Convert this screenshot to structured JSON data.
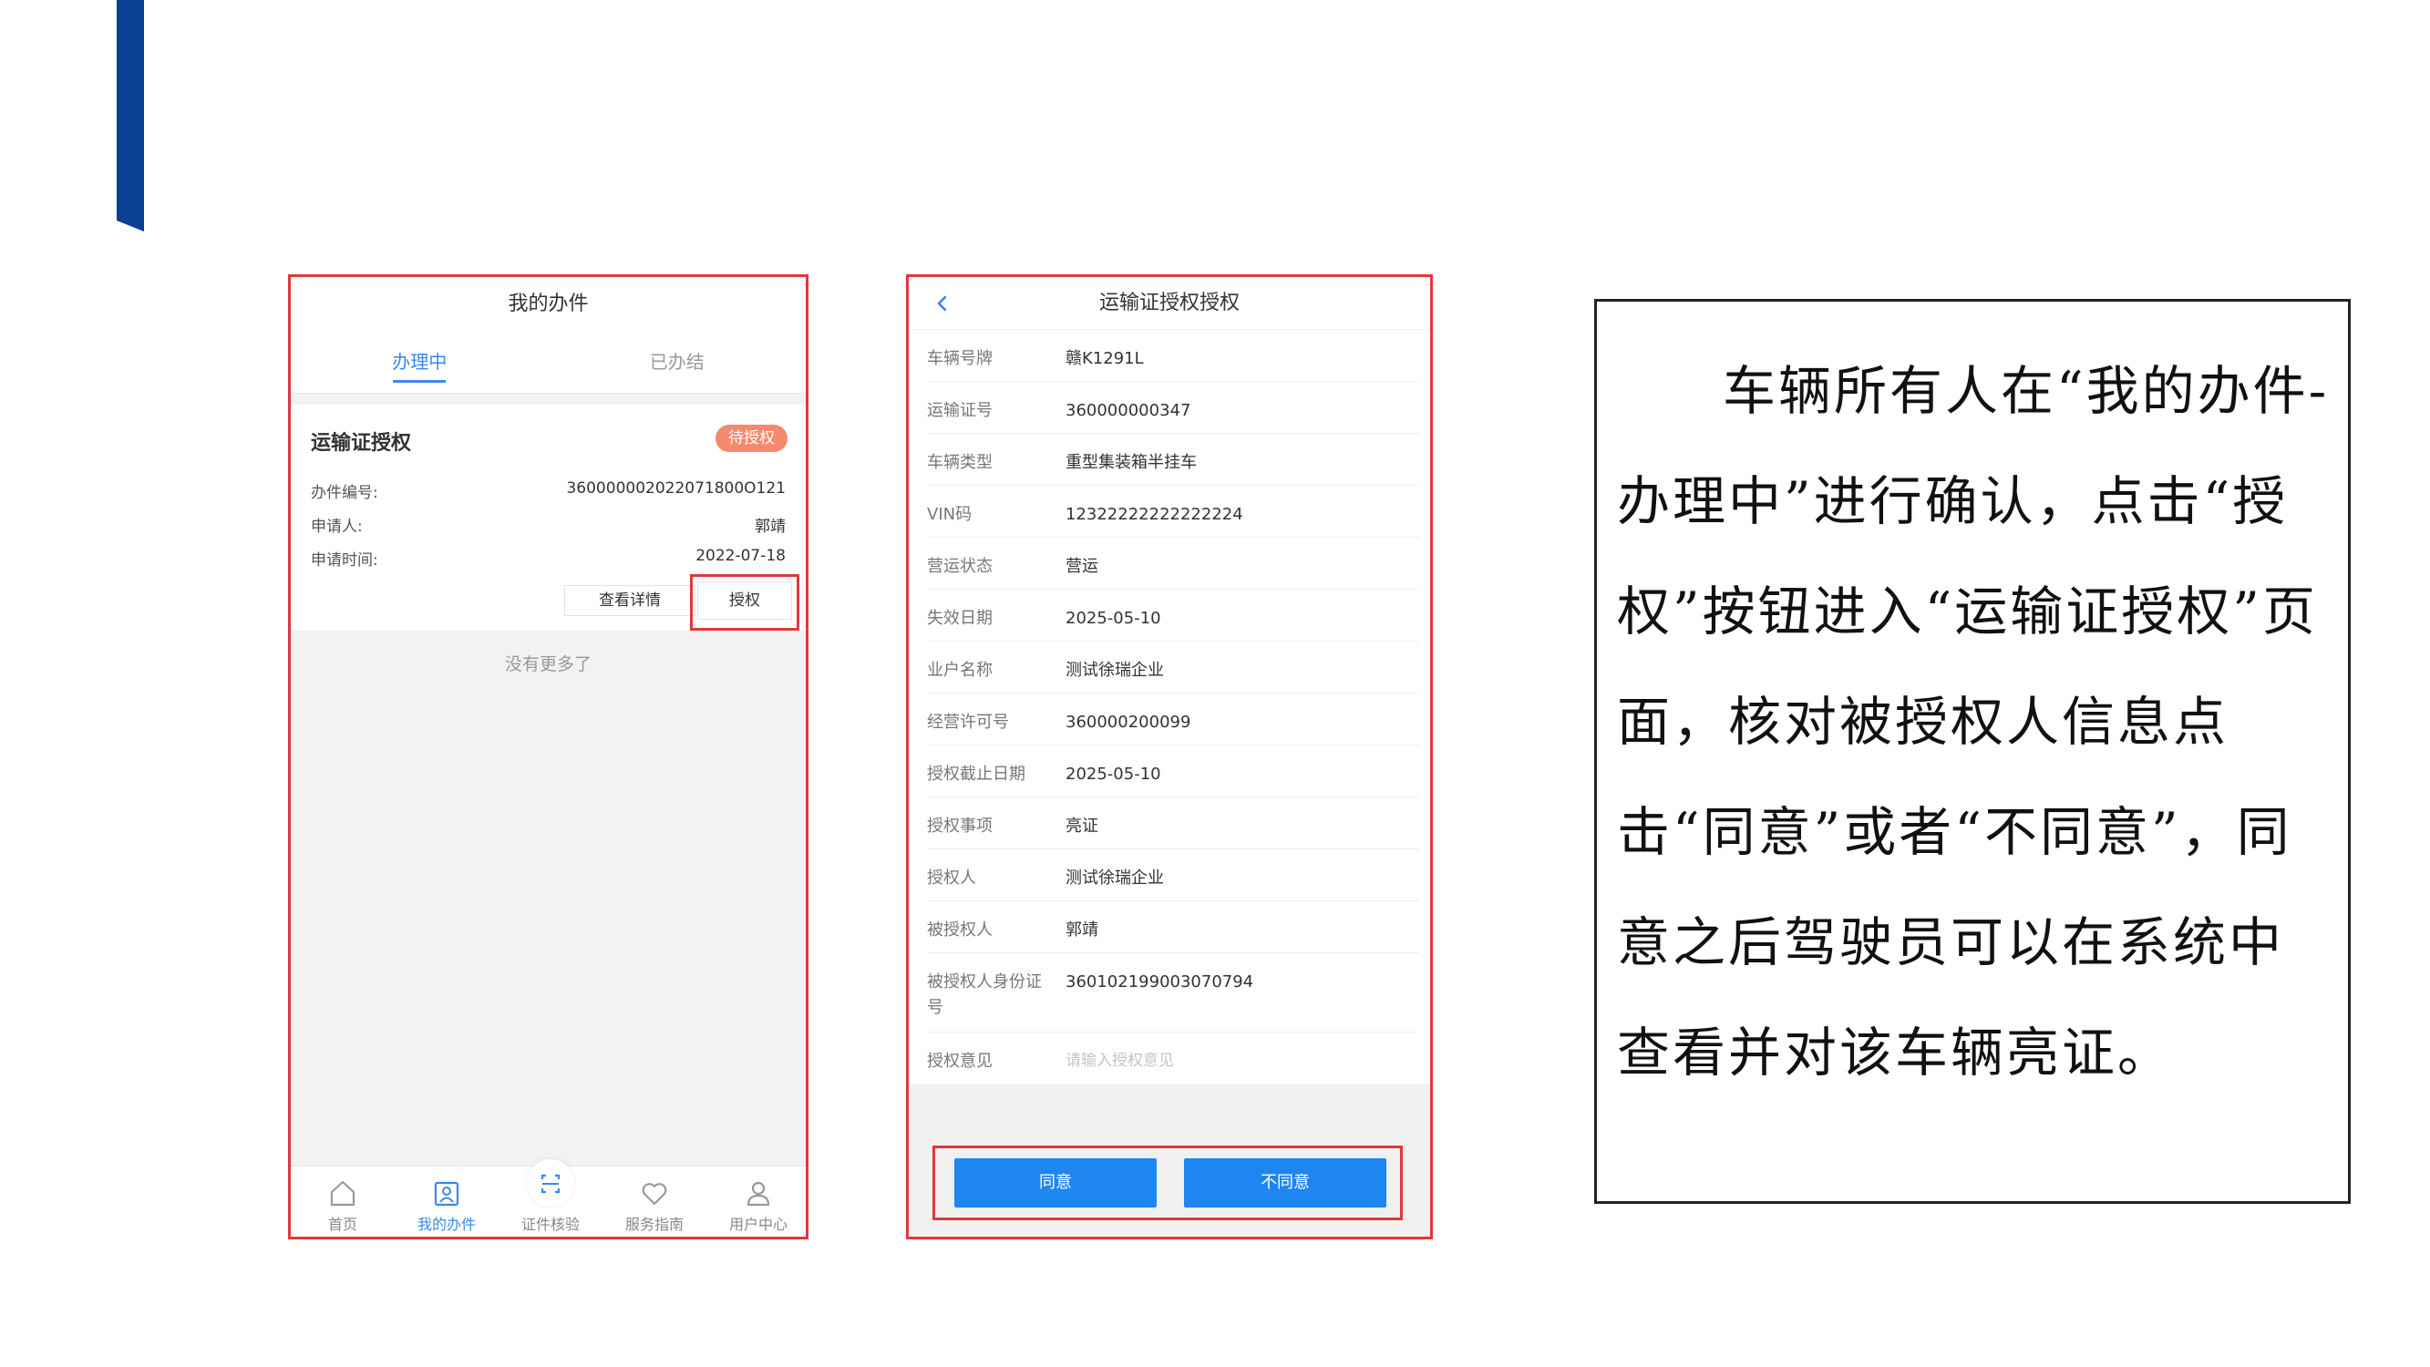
{
  "phone1": {
    "header_title": "我的办件",
    "tabs": [
      {
        "label": "办理中",
        "active": true
      },
      {
        "label": "已办结",
        "active": false
      }
    ],
    "card": {
      "title": "运输证授权",
      "badge": "待授权",
      "badge_color": "#f5896e",
      "rows": [
        {
          "key": "办件编号:",
          "value": "360000002022071800O121"
        },
        {
          "key": "申请人:",
          "value": "郭靖"
        },
        {
          "key": "申请时间:",
          "value": "2022-07-18"
        }
      ],
      "detail_button": "查看详情",
      "authorize_button": "授权"
    },
    "no_more_text": "没有更多了",
    "tabbar": [
      {
        "label": "首页",
        "icon": "home-icon",
        "active": false
      },
      {
        "label": "我的办件",
        "icon": "my-cases-icon",
        "active": true
      },
      {
        "label": "证件核验",
        "icon": "scan-icon",
        "active": false
      },
      {
        "label": "服务指南",
        "icon": "service-guide-icon",
        "active": false
      },
      {
        "label": "用户中心",
        "icon": "user-icon",
        "active": false
      }
    ]
  },
  "phone2": {
    "header_title": "运输证授权授权",
    "back_icon": "chevron-left-icon",
    "fields": [
      {
        "key": "车辆号牌",
        "value": "赣K1291L"
      },
      {
        "key": "运输证号",
        "value": "360000000347"
      },
      {
        "key": "车辆类型",
        "value": "重型集装箱半挂车"
      },
      {
        "key": "VIN码",
        "value": "12322222222222224"
      },
      {
        "key": "营运状态",
        "value": "营运"
      },
      {
        "key": "失效日期",
        "value": "2025-05-10"
      },
      {
        "key": "业户名称",
        "value": "测试徐瑞企业"
      },
      {
        "key": "经营许可号",
        "value": "360000200099"
      },
      {
        "key": "授权截止日期",
        "value": "2025-05-10"
      },
      {
        "key": "授权事项",
        "value": "亮证"
      },
      {
        "key": "授权人",
        "value": "测试徐瑞企业"
      },
      {
        "key": "被授权人",
        "value": "郭靖"
      },
      {
        "key": "被授权人身份证号",
        "value": "360102199003070794"
      }
    ],
    "opinion": {
      "key": "授权意见",
      "value": "",
      "placeholder": "请输入授权意见"
    },
    "agree_button": "同意",
    "disagree_button": "不同意",
    "button_color": "#1e86f0"
  },
  "description": "车辆所有人在“我的办件-办理中”进行确认，点击“授权”按钮进入“运输证授权”页面，核对被授权人信息点击“同意”或者“不同意”，同意之后驾驶员可以在系统中查看并对该车辆亮证。",
  "colors": {
    "accent_bar": "#0b3f93",
    "highlight_border": "#e0383c",
    "active_blue": "#3c87e8"
  }
}
